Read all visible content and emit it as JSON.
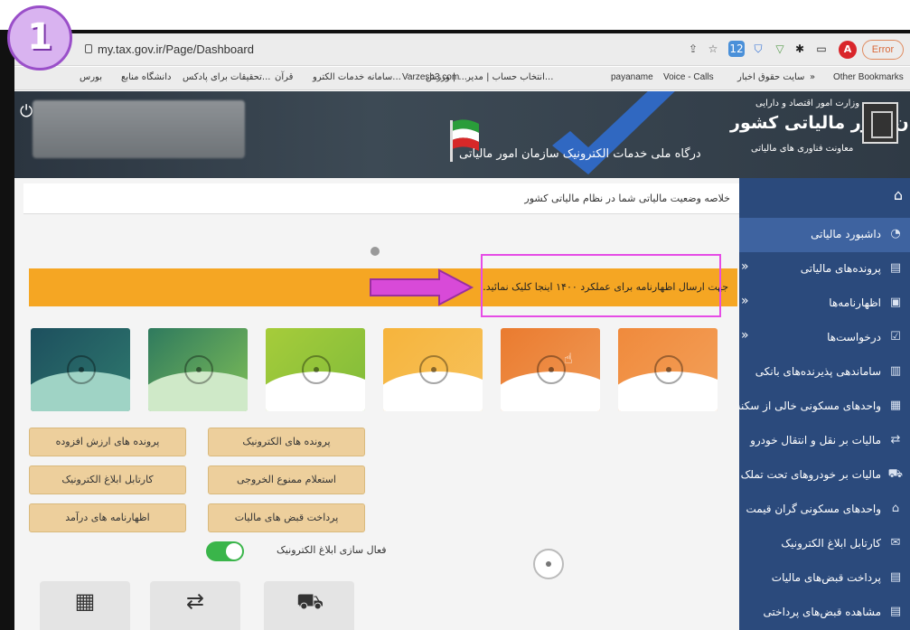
{
  "step_badge": "1",
  "browser": {
    "url": "my.tax.gov.ir/Page/Dashboard",
    "error_label": "Error",
    "avatar_letter": "A",
    "ext_badge": "12"
  },
  "bookmarks": {
    "items": [
      "بورس",
      "دانشگاه منابع",
      "تحقیقات برای پادکس...",
      "قرآن",
      "سامانه خدمات الکترو...",
      "ورزش | ...",
      "انتخاب حساب | مدیر...",
      "Varzesh3.com",
      "payaname",
      "Voice - Calls",
      "سایت حقوق اخبار",
      "»",
      "Other Bookmarks"
    ]
  },
  "header": {
    "org_ministry": "وزارت امور اقتصاد و دارایی",
    "org_name": "سازمان امور مالیاتی کشور",
    "org_deputy": "معاونت فناوری های مالیاتی",
    "portal_title": "درگاه ملی خدمات الکترونیک سازمان امور مالیاتی"
  },
  "sidebar": {
    "items": [
      {
        "label": "داشبورد مالیاتی",
        "icon": "dashboard-icon",
        "active": true
      },
      {
        "label": "پرونده‌های مالیاتی",
        "icon": "folder-icon",
        "chevron": "«"
      },
      {
        "label": "اظهارنامه‌ها",
        "icon": "document-icon",
        "chevron": "«"
      },
      {
        "label": "درخواست‌ها",
        "icon": "check-icon",
        "chevron": "«"
      },
      {
        "label": "ساماندهی پذیرنده‌های بانکی",
        "icon": "bank-icon"
      },
      {
        "label": "واحدهای مسکونی خالی از سکنه",
        "icon": "building-icon"
      },
      {
        "label": "مالیات بر نقل و انتقال خودرو",
        "icon": "car-transfer-icon"
      },
      {
        "label": "مالیات بر خودروهای تحت تملک",
        "icon": "car-icon"
      },
      {
        "label": "واحدهای مسکونی گران قیمت",
        "icon": "house-icon"
      },
      {
        "label": "کارتابل ابلاغ الکترونیک",
        "icon": "inbox-icon"
      },
      {
        "label": "پرداخت قبض‌های مالیات",
        "icon": "receipt-icon"
      },
      {
        "label": "مشاهده قبض‌های پرداختی",
        "icon": "receipt-view-icon"
      }
    ]
  },
  "main": {
    "summary": "خلاصه وضعیت مالیاتی شما در نظام مالیاتی کشور",
    "banner": "جهت ارسال اظهارنامه برای عملکرد ۱۴۰۰ اینجا کلیک نمائید.",
    "cards": [
      {
        "color_top": "#f08a3c",
        "color_bottom": "#f3a15a"
      },
      {
        "color_top": "#ea7b2f",
        "color_bottom": "#f09a56"
      },
      {
        "color_top": "#f6b43c",
        "color_bottom": "#f7c25c"
      },
      {
        "color_top": "#a6cc3a",
        "color_bottom": "#7fbb3a"
      },
      {
        "color_top": "#5aa04a",
        "color_bottom": "#7fbf57"
      },
      {
        "color_top": "#1d4f5e",
        "color_bottom": "#2f7a6e"
      }
    ],
    "quick_buttons": [
      "پرونده های الکترونیک",
      "پرونده های ارزش افزوده",
      "استعلام ممنوع الخروجی",
      "کارتابل ابلاغ الکترونیک",
      "پرداخت قبض های مالیات",
      "اظهارنامه های درآمد"
    ],
    "toggle_label": "فعال سازی ابلاغ الکترونیک"
  }
}
